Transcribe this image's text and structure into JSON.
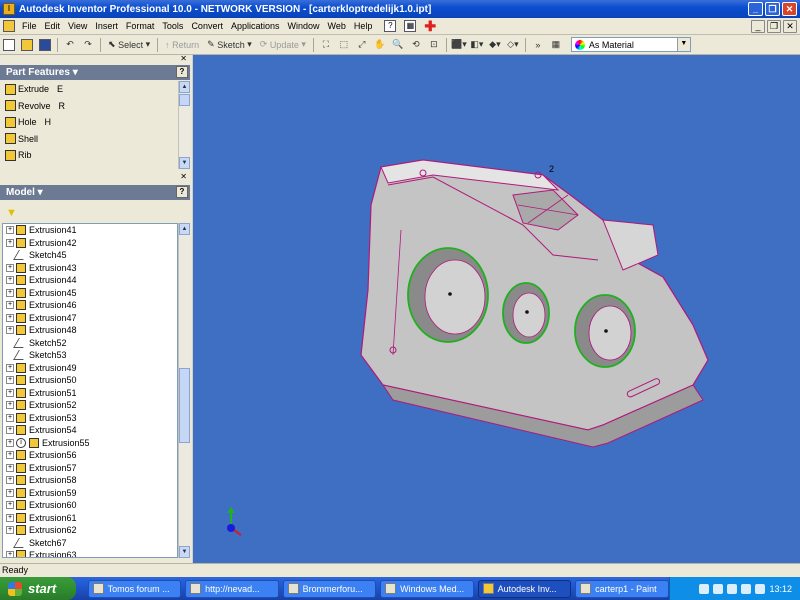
{
  "window": {
    "title": "Autodesk Inventor Professional 10.0 - NETWORK VERSION - [carterkloptredelijk1.0.ipt]"
  },
  "menu": [
    "File",
    "Edit",
    "View",
    "Insert",
    "Format",
    "Tools",
    "Convert",
    "Applications",
    "Window",
    "Web",
    "Help"
  ],
  "toolbar": {
    "select_label": "Select",
    "return_label": "Return",
    "sketch_label": "Sketch",
    "update_label": "Update",
    "material_value": "As Material"
  },
  "part_features": {
    "title": "Part Features",
    "items": [
      {
        "label": "Extrude",
        "key": "E"
      },
      {
        "label": "Revolve",
        "key": "R"
      },
      {
        "label": "Hole",
        "key": "H"
      },
      {
        "label": "Shell",
        "key": ""
      },
      {
        "label": "Rib",
        "key": ""
      }
    ]
  },
  "model": {
    "title": "Model",
    "items": [
      {
        "label": "Extrusion41",
        "type": "extrusion"
      },
      {
        "label": "Extrusion42",
        "type": "extrusion"
      },
      {
        "label": "Sketch45",
        "type": "sketch"
      },
      {
        "label": "Extrusion43",
        "type": "extrusion"
      },
      {
        "label": "Extrusion44",
        "type": "extrusion"
      },
      {
        "label": "Extrusion45",
        "type": "extrusion"
      },
      {
        "label": "Extrusion46",
        "type": "extrusion"
      },
      {
        "label": "Extrusion47",
        "type": "extrusion"
      },
      {
        "label": "Extrusion48",
        "type": "extrusion"
      },
      {
        "label": "Sketch52",
        "type": "sketch"
      },
      {
        "label": "Sketch53",
        "type": "sketch"
      },
      {
        "label": "Extrusion49",
        "type": "extrusion"
      },
      {
        "label": "Extrusion50",
        "type": "extrusion"
      },
      {
        "label": "Extrusion51",
        "type": "extrusion"
      },
      {
        "label": "Extrusion52",
        "type": "extrusion"
      },
      {
        "label": "Extrusion53",
        "type": "extrusion"
      },
      {
        "label": "Extrusion54",
        "type": "extrusion"
      },
      {
        "label": "Extrusion55",
        "type": "info"
      },
      {
        "label": "Extrusion56",
        "type": "extrusion"
      },
      {
        "label": "Extrusion57",
        "type": "extrusion"
      },
      {
        "label": "Extrusion58",
        "type": "extrusion"
      },
      {
        "label": "Extrusion59",
        "type": "extrusion"
      },
      {
        "label": "Extrusion60",
        "type": "extrusion"
      },
      {
        "label": "Extrusion61",
        "type": "extrusion"
      },
      {
        "label": "Extrusion62",
        "type": "extrusion"
      },
      {
        "label": "Sketch67",
        "type": "sketch"
      },
      {
        "label": "Extrusion63",
        "type": "extrusion"
      }
    ]
  },
  "viewport": {
    "background": "#3e6fc2",
    "dimension_label": "2"
  },
  "status": {
    "text": "Ready"
  },
  "taskbar": {
    "start_label": "start",
    "tasks": [
      {
        "label": "Tomos forum ...",
        "active": false
      },
      {
        "label": "http://nevad...",
        "active": false
      },
      {
        "label": "Brommerforu...",
        "active": false
      },
      {
        "label": "Windows Med...",
        "active": false
      },
      {
        "label": "Autodesk Inv...",
        "active": true
      },
      {
        "label": "carterp1 - Paint",
        "active": false
      }
    ],
    "clock": "13:12"
  }
}
